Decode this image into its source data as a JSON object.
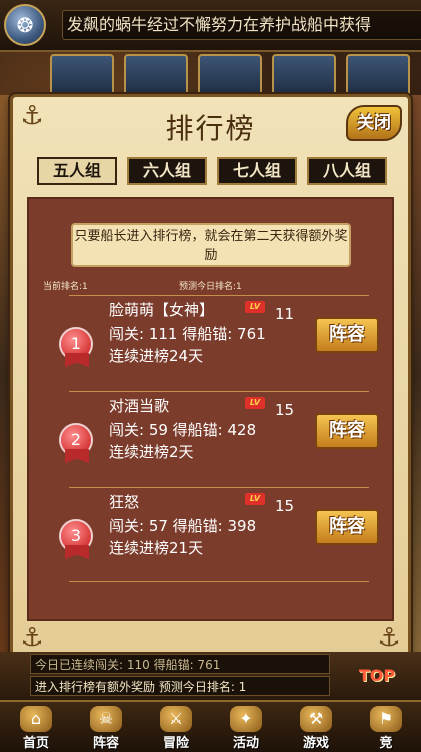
{
  "marquee": {
    "text": "发飙的蜗牛经过不懈努力在养护战船中获得"
  },
  "dialog": {
    "title": "排行榜",
    "close_label": "关闭",
    "tabs": [
      {
        "label": "五人组",
        "active": true
      },
      {
        "label": "六人组",
        "active": false
      },
      {
        "label": "七人组",
        "active": false
      },
      {
        "label": "八人组",
        "active": false
      }
    ],
    "notice": "只要船长进入排行榜，就会在第二天获得额外奖励",
    "current_rank": "当前排名:1",
    "predicted_rank": "预测今日排名:1",
    "entries": [
      {
        "rank": "1",
        "name": "脸萌萌【女神】",
        "lv_label": "LV",
        "level": "11",
        "stats": "闯关: 111  得船锚: 761",
        "streak": "连续进榜24天",
        "button": "阵容"
      },
      {
        "rank": "2",
        "name": "对酒当歌",
        "lv_label": "LV",
        "level": "15",
        "stats": "闯关: 59  得船锚: 428",
        "streak": "连续进榜2天",
        "button": "阵容"
      },
      {
        "rank": "3",
        "name": "狂怒",
        "lv_label": "LV",
        "level": "15",
        "stats": "闯关: 57  得船锚: 398",
        "streak": "连续进榜21天",
        "button": "阵容"
      }
    ]
  },
  "hud": {
    "line1": "今日已连续闯关: 110   得船锚: 761",
    "line2": "进入排行榜有额外奖励   预测今日排名: 1",
    "top_label": "TOP"
  },
  "nav": [
    {
      "label": "首页",
      "icon": "home-icon"
    },
    {
      "label": "阵容",
      "icon": "lineup-icon"
    },
    {
      "label": "冒险",
      "icon": "adventure-icon"
    },
    {
      "label": "活动",
      "icon": "event-icon"
    },
    {
      "label": "游戏",
      "icon": "game-icon"
    },
    {
      "label": "竞",
      "icon": "arena-icon"
    }
  ]
}
